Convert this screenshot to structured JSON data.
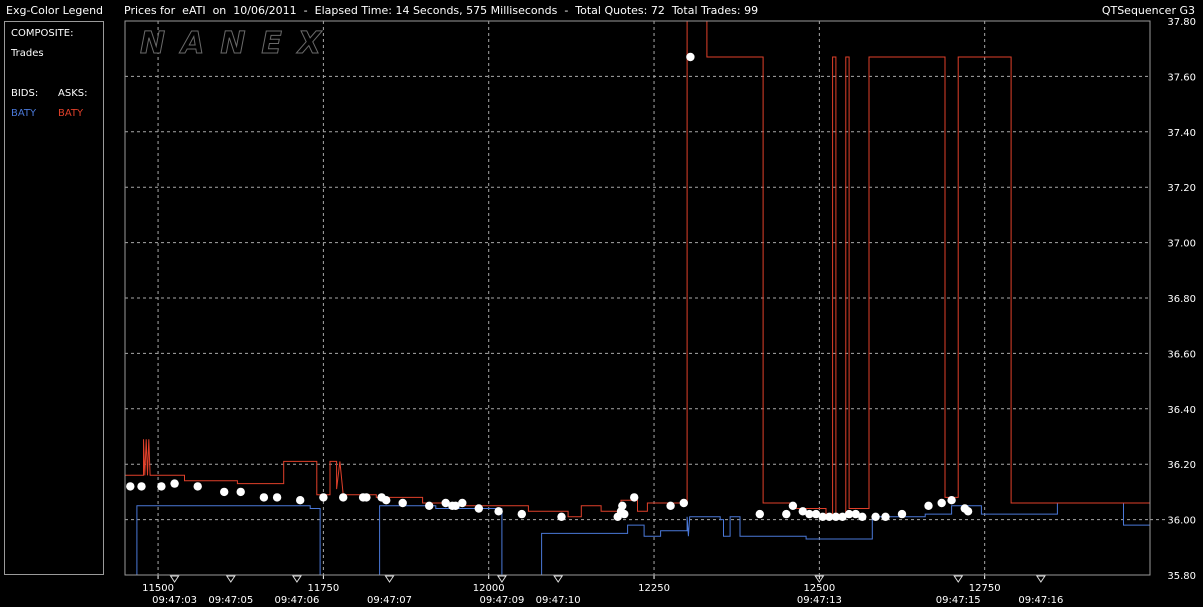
{
  "header": {
    "legend_title": "Exg-Color Legend",
    "chart_title": "Prices for  eATI  on  10/06/2011  -  Elapsed Time: 14 Seconds, 575 Milliseconds  -  Total Quotes: 72  Total Trades: 99",
    "app_name": "QTSequencer G3"
  },
  "legend": {
    "composite_label": "COMPOSITE:",
    "trades_label": "Trades",
    "bids_label": "BIDS:",
    "asks_label": "ASKS:",
    "bid_exchange": "BATY",
    "ask_exchange": "BATY"
  },
  "watermark": "NANEX",
  "colors": {
    "bid": "#4a78d8",
    "ask": "#e0402a",
    "trade": "#ffffff",
    "grid": "#a8a8a8",
    "frame": "#9a9a9a"
  },
  "chart_data": {
    "type": "line",
    "xlim": [
      11450,
      13000
    ],
    "ylim": [
      35.8,
      37.8
    ],
    "grid": true,
    "x_ticks": [
      11500,
      11750,
      12000,
      12250,
      12500,
      12750
    ],
    "y_ticks": [
      "37.80",
      "37.60",
      "37.40",
      "37.20",
      "37.00",
      "36.80",
      "36.60",
      "36.40",
      "36.20",
      "36.00",
      "35.80"
    ],
    "time_labels": [
      {
        "x": 11525,
        "label": "09:47:03"
      },
      {
        "x": 11610,
        "label": "09:47:05"
      },
      {
        "x": 11710,
        "label": "09:47:06"
      },
      {
        "x": 11850,
        "label": "09:47:07"
      },
      {
        "x": 12020,
        "label": "09:47:09"
      },
      {
        "x": 12105,
        "label": "09:47:10"
      },
      {
        "x": 12500,
        "label": "09:47:13"
      },
      {
        "x": 12710,
        "label": "09:47:15"
      },
      {
        "x": 12835,
        "label": "09:47:16"
      }
    ],
    "dashed_ref_y": 36.0,
    "series": [
      {
        "name": "BATY",
        "role": "bid",
        "points": [
          [
            11450,
            35.79
          ],
          [
            11468,
            35.79
          ],
          [
            11468,
            36.05
          ],
          [
            11730,
            36.05
          ],
          [
            11730,
            36.04
          ],
          [
            11745,
            36.04
          ],
          [
            11745,
            35.79
          ],
          [
            11835,
            35.79
          ],
          [
            11835,
            36.05
          ],
          [
            11920,
            36.05
          ],
          [
            11920,
            36.04
          ],
          [
            12020,
            36.04
          ],
          [
            12020,
            35.79
          ],
          [
            12080,
            35.79
          ],
          [
            12080,
            35.95
          ],
          [
            12210,
            35.95
          ],
          [
            12210,
            35.98
          ],
          [
            12235,
            35.98
          ],
          [
            12235,
            35.94
          ],
          [
            12260,
            35.94
          ],
          [
            12260,
            35.96
          ],
          [
            12300,
            35.96
          ],
          [
            12300,
            36.01
          ],
          [
            12302,
            35.94
          ],
          [
            12304,
            36.01
          ],
          [
            12350,
            36.01
          ],
          [
            12350,
            36.0
          ],
          [
            12355,
            36.0
          ],
          [
            12355,
            35.94
          ],
          [
            12365,
            35.94
          ],
          [
            12365,
            36.01
          ],
          [
            12380,
            36.01
          ],
          [
            12380,
            35.94
          ],
          [
            12480,
            35.94
          ],
          [
            12480,
            35.93
          ],
          [
            12580,
            35.93
          ],
          [
            12580,
            36.01
          ],
          [
            12660,
            36.01
          ],
          [
            12660,
            36.02
          ],
          [
            12700,
            36.02
          ],
          [
            12700,
            36.05
          ],
          [
            12745,
            36.05
          ],
          [
            12745,
            36.02
          ],
          [
            12860,
            36.02
          ],
          [
            12860,
            36.06
          ],
          [
            12960,
            36.06
          ],
          [
            12960,
            35.98
          ],
          [
            13000,
            35.98
          ]
        ]
      },
      {
        "name": "BATY",
        "role": "ask",
        "points": [
          [
            11450,
            36.16
          ],
          [
            11478,
            36.16
          ],
          [
            11478,
            36.29
          ],
          [
            11480,
            36.16
          ],
          [
            11482,
            36.29
          ],
          [
            11484,
            36.16
          ],
          [
            11486,
            36.29
          ],
          [
            11488,
            36.16
          ],
          [
            11540,
            36.16
          ],
          [
            11540,
            36.14
          ],
          [
            11620,
            36.14
          ],
          [
            11620,
            36.13
          ],
          [
            11690,
            36.13
          ],
          [
            11690,
            36.21
          ],
          [
            11740,
            36.21
          ],
          [
            11740,
            36.09
          ],
          [
            11760,
            36.09
          ],
          [
            11760,
            36.21
          ],
          [
            11770,
            36.21
          ],
          [
            11770,
            36.11
          ],
          [
            11775,
            36.21
          ],
          [
            11780,
            36.09
          ],
          [
            11830,
            36.09
          ],
          [
            11830,
            36.08
          ],
          [
            11900,
            36.08
          ],
          [
            11900,
            36.06
          ],
          [
            11960,
            36.06
          ],
          [
            11960,
            36.05
          ],
          [
            12060,
            36.05
          ],
          [
            12060,
            36.03
          ],
          [
            12120,
            36.03
          ],
          [
            12120,
            36.01
          ],
          [
            12140,
            36.01
          ],
          [
            12140,
            36.05
          ],
          [
            12170,
            36.05
          ],
          [
            12170,
            36.03
          ],
          [
            12200,
            36.03
          ],
          [
            12200,
            36.07
          ],
          [
            12225,
            36.07
          ],
          [
            12225,
            36.03
          ],
          [
            12240,
            36.03
          ],
          [
            12240,
            36.06
          ],
          [
            12300,
            36.06
          ],
          [
            12300,
            37.85
          ],
          [
            12330,
            37.85
          ],
          [
            12330,
            37.67
          ],
          [
            12415,
            37.67
          ],
          [
            12415,
            36.06
          ],
          [
            12460,
            36.06
          ],
          [
            12460,
            36.04
          ],
          [
            12510,
            36.04
          ],
          [
            12510,
            36.02
          ],
          [
            12520,
            36.02
          ],
          [
            12520,
            37.67
          ],
          [
            12525,
            37.67
          ],
          [
            12525,
            36.02
          ],
          [
            12540,
            36.02
          ],
          [
            12540,
            37.67
          ],
          [
            12545,
            37.67
          ],
          [
            12545,
            36.04
          ],
          [
            12575,
            36.04
          ],
          [
            12575,
            37.67
          ],
          [
            12690,
            37.67
          ],
          [
            12690,
            36.08
          ],
          [
            12710,
            36.08
          ],
          [
            12710,
            37.67
          ],
          [
            12790,
            37.67
          ],
          [
            12790,
            36.06
          ],
          [
            13000,
            36.06
          ]
        ]
      }
    ],
    "trades": [
      [
        11458,
        36.12
      ],
      [
        11475,
        36.12
      ],
      [
        11505,
        36.12
      ],
      [
        11525,
        36.13
      ],
      [
        11560,
        36.12
      ],
      [
        11600,
        36.1
      ],
      [
        11625,
        36.1
      ],
      [
        11660,
        36.08
      ],
      [
        11680,
        36.08
      ],
      [
        11715,
        36.07
      ],
      [
        11750,
        36.08
      ],
      [
        11780,
        36.08
      ],
      [
        11810,
        36.08
      ],
      [
        11815,
        36.08
      ],
      [
        11838,
        36.08
      ],
      [
        11845,
        36.07
      ],
      [
        11870,
        36.06
      ],
      [
        11910,
        36.05
      ],
      [
        11935,
        36.06
      ],
      [
        11945,
        36.05
      ],
      [
        11950,
        36.05
      ],
      [
        11960,
        36.06
      ],
      [
        11985,
        36.04
      ],
      [
        12015,
        36.03
      ],
      [
        12050,
        36.02
      ],
      [
        12110,
        36.01
      ],
      [
        12195,
        36.01
      ],
      [
        12200,
        36.03
      ],
      [
        12202,
        36.05
      ],
      [
        12205,
        36.02
      ],
      [
        12220,
        36.08
      ],
      [
        12275,
        36.05
      ],
      [
        12295,
        36.06
      ],
      [
        12305,
        37.67
      ],
      [
        12410,
        36.02
      ],
      [
        12450,
        36.02
      ],
      [
        12460,
        36.05
      ],
      [
        12475,
        36.03
      ],
      [
        12485,
        36.02
      ],
      [
        12495,
        36.02
      ],
      [
        12505,
        36.01
      ],
      [
        12515,
        36.01
      ],
      [
        12525,
        36.01
      ],
      [
        12535,
        36.01
      ],
      [
        12545,
        36.02
      ],
      [
        12555,
        36.02
      ],
      [
        12565,
        36.01
      ],
      [
        12585,
        36.01
      ],
      [
        12600,
        36.01
      ],
      [
        12625,
        36.02
      ],
      [
        12665,
        36.05
      ],
      [
        12685,
        36.06
      ],
      [
        12700,
        36.07
      ],
      [
        12720,
        36.04
      ],
      [
        12725,
        36.03
      ]
    ]
  }
}
